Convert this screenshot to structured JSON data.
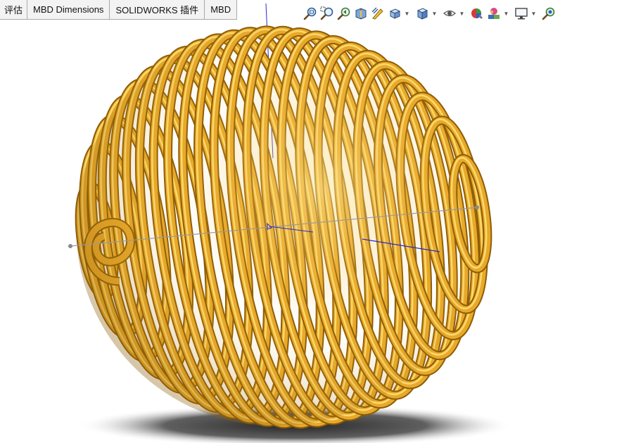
{
  "tabs": [
    {
      "label": "评估"
    },
    {
      "label": "MBD Dimensions"
    },
    {
      "label": "SOLIDWORKS 插件"
    },
    {
      "label": "MBD"
    }
  ],
  "toolbar": {
    "icons": [
      "zoom-to-fit-icon",
      "zoom-to-area-icon",
      "previous-view-icon",
      "section-view-icon",
      "dynamic-annotation-icon",
      "view-orientation-icon",
      "display-style-icon",
      "hide-show-items-icon",
      "edit-appearance-icon",
      "apply-scene-icon",
      "view-settings-icon",
      "realview-icon"
    ]
  },
  "model": {
    "name": "spherical-coil",
    "color": "#e8a92a",
    "shadow_color": "#2a2a2a"
  },
  "colors": {
    "accent": "#1a5fb4",
    "axis_blue": "#2a2ad0",
    "axis_gray": "#9a9a9a"
  }
}
